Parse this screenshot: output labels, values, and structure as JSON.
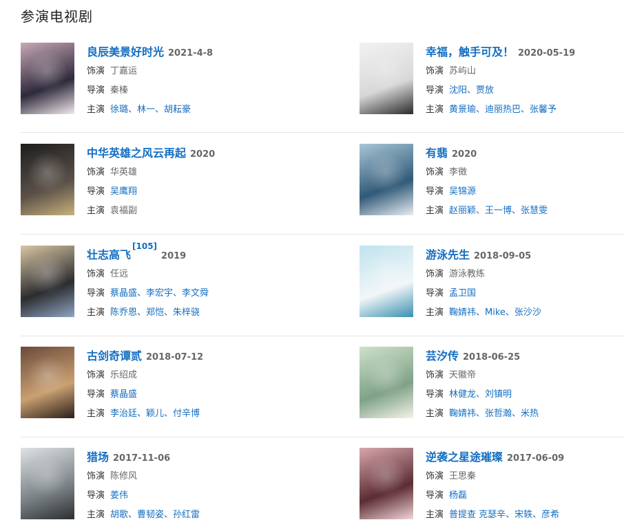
{
  "section_title": "参演电视剧",
  "labels": {
    "role": "饰演",
    "director": "导演",
    "cast": "主演"
  },
  "dramas": [
    {
      "title": "良辰美景好时光",
      "ref": "",
      "date": "2021-4-8",
      "role": "丁嘉运",
      "director": "秦榛",
      "director_link": false,
      "cast": "徐璐、林一、胡耘豪",
      "cast_link": true,
      "poster_colors": [
        "#c9a9b6",
        "#2e2a3b",
        "#f3e9ee"
      ]
    },
    {
      "title": "幸福，触手可及！",
      "ref": "",
      "date": "2020-05-19",
      "role": "苏屿山",
      "director": "沈阳、贾放",
      "director_link": true,
      "cast": "黄景瑜、迪丽热巴、张馨予",
      "cast_link": true,
      "poster_colors": [
        "#f2f2f2",
        "#d8d8d8",
        "#2b2b2b"
      ]
    },
    {
      "title": "中华英雄之风云再起",
      "ref": "",
      "date": "2020",
      "role": "华英雄",
      "director": "吴鹰翔",
      "director_link": true,
      "cast": "袁福副",
      "cast_link": false,
      "poster_colors": [
        "#1d1d1d",
        "#5a5048",
        "#c8b27a"
      ]
    },
    {
      "title": "有翡",
      "ref": "",
      "date": "2020",
      "role": "李徵",
      "director": "吴锦源",
      "director_link": true,
      "cast": "赵丽颖、王一博、张慧雯",
      "cast_link": true,
      "poster_colors": [
        "#a8c6d6",
        "#315a78",
        "#e8eef2"
      ]
    },
    {
      "title": "壮志高飞",
      "ref": "[105]",
      "date": "2019",
      "role": "任远",
      "director": "蔡晶盛、李宏宇、李文舜",
      "director_link": true,
      "cast": "陈乔恩、郑恺、朱梓骁",
      "cast_link": true,
      "poster_colors": [
        "#d9c7a3",
        "#2c2c30",
        "#8ea6c2"
      ]
    },
    {
      "title": "游泳先生",
      "ref": "",
      "date": "2018-09-05",
      "role": "游泳教练",
      "director": "孟卫国",
      "director_link": true,
      "cast": "鞠婧祎、Mike、张沙沙",
      "cast_link": true,
      "poster_colors": [
        "#bfe3ee",
        "#f2f6f8",
        "#3a8fb0"
      ]
    },
    {
      "title": "古剑奇谭贰",
      "ref": "",
      "date": "2018-07-12",
      "role": "乐绍成",
      "director": "蔡晶盛",
      "director_link": true,
      "cast": "李治廷、颖儿、付辛博",
      "cast_link": true,
      "poster_colors": [
        "#6b4a3a",
        "#c9a071",
        "#2a1f1a"
      ]
    },
    {
      "title": "芸汐传",
      "ref": "",
      "date": "2018-06-25",
      "role": "天徽帝",
      "director": "林健龙、刘镇明",
      "director_link": true,
      "cast": "鞠婧祎、张哲瀚、米热",
      "cast_link": true,
      "poster_colors": [
        "#cfe0c9",
        "#7fa287",
        "#f4f3ea"
      ]
    },
    {
      "title": "猎场",
      "ref": "",
      "date": "2017-11-06",
      "role": "陈修风",
      "director": "姜伟",
      "director_link": true,
      "cast": "胡歌、曹韧姿、孙红雷",
      "cast_link": true,
      "poster_colors": [
        "#dfe3e5",
        "#7a8185",
        "#2c2f31"
      ]
    },
    {
      "title": "逆袭之星途璀璨",
      "ref": "",
      "date": "2017-06-09",
      "role": "王思秦",
      "director": "杨磊",
      "director_link": true,
      "cast": "普提查 克瑟辛、宋轶、彦希",
      "cast_link": true,
      "poster_colors": [
        "#d7a7ad",
        "#5b2c33",
        "#f1d5d8"
      ]
    }
  ]
}
